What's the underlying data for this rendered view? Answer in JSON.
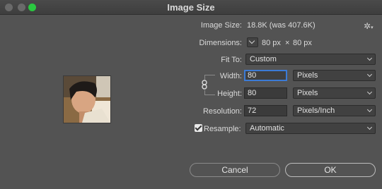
{
  "window": {
    "title": "Image Size"
  },
  "image_size": {
    "label": "Image Size:",
    "value": "18.8K (was 407.6K)"
  },
  "dimensions": {
    "label": "Dimensions:",
    "width": "80 px",
    "times": "×",
    "height": "80 px"
  },
  "fit_to": {
    "label": "Fit To:",
    "value": "Custom"
  },
  "width": {
    "label": "Width:",
    "value": "80",
    "unit": "Pixels"
  },
  "height": {
    "label": "Height:",
    "value": "80",
    "unit": "Pixels"
  },
  "resolution": {
    "label": "Resolution:",
    "value": "72",
    "unit": "Pixels/Inch"
  },
  "resample": {
    "label": "Resample:",
    "checked": true,
    "value": "Automatic"
  },
  "buttons": {
    "cancel": "Cancel",
    "ok": "OK"
  },
  "icons": {
    "settings": "gear-icon",
    "constrain": "link-icon",
    "dimensions_menu": "chevron-down-icon"
  },
  "colors": {
    "accent": "#3b7bd6",
    "maximize": "#2ac840",
    "background": "#535353"
  }
}
